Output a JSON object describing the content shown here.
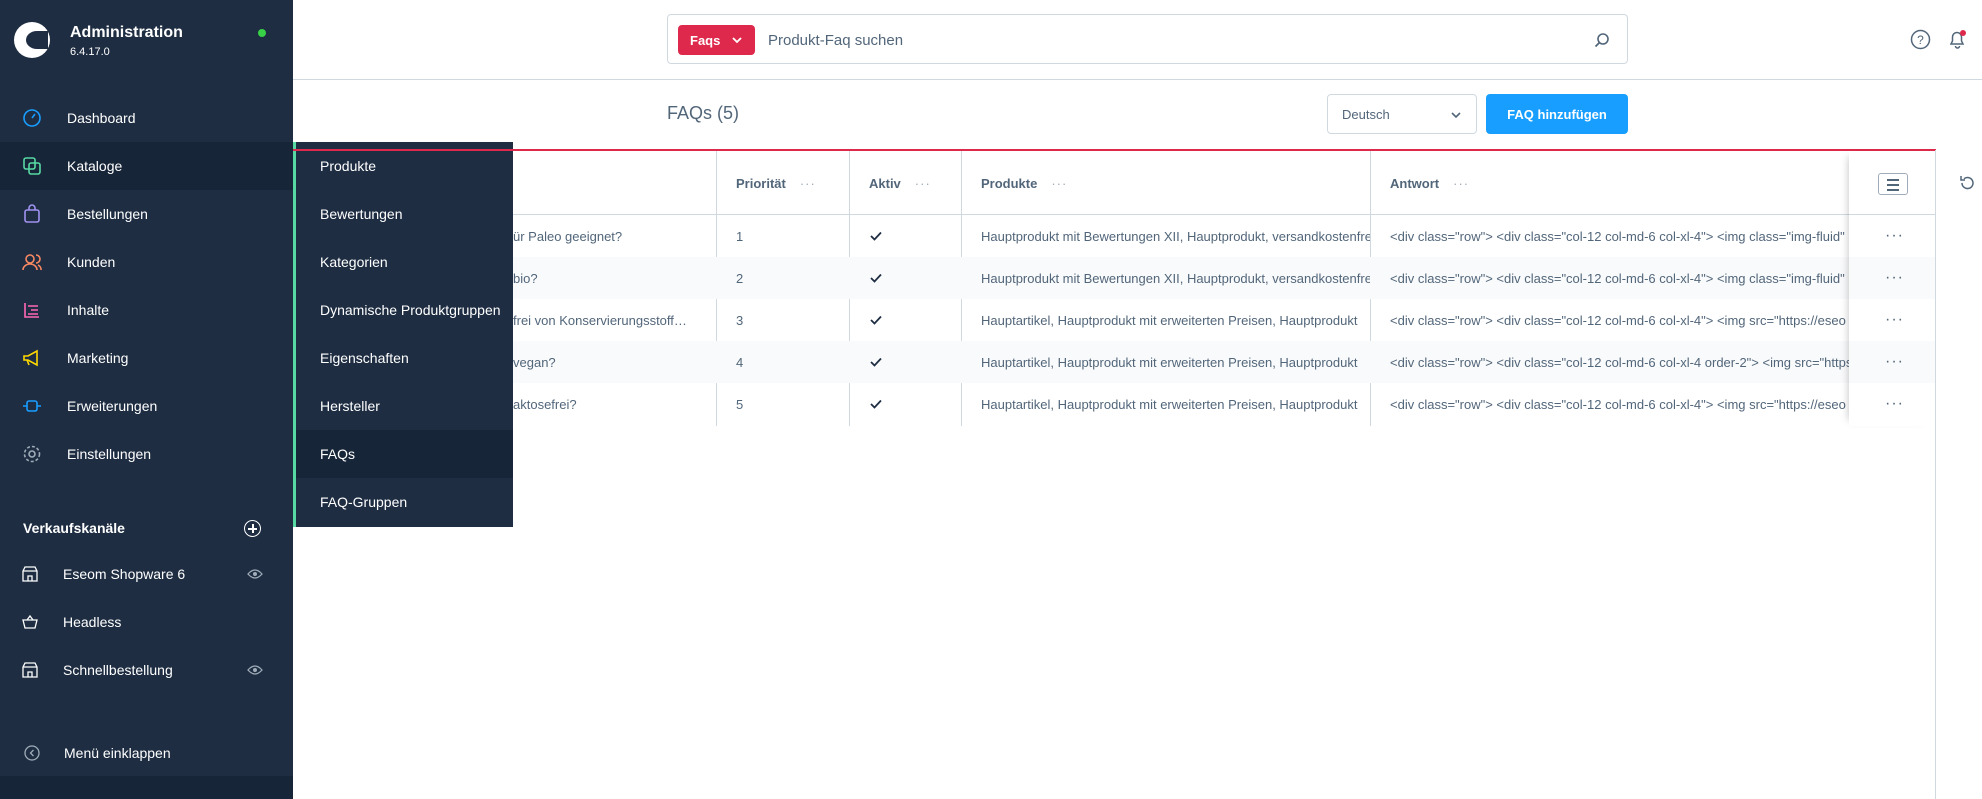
{
  "brand": {
    "title": "Administration",
    "version": "6.4.17.0"
  },
  "nav": {
    "items": [
      {
        "label": "Dashboard",
        "icon": "dashboard-icon"
      },
      {
        "label": "Kataloge",
        "icon": "catalog-icon"
      },
      {
        "label": "Bestellungen",
        "icon": "orders-icon"
      },
      {
        "label": "Kunden",
        "icon": "customers-icon"
      },
      {
        "label": "Inhalte",
        "icon": "content-icon"
      },
      {
        "label": "Marketing",
        "icon": "marketing-icon"
      },
      {
        "label": "Erweiterungen",
        "icon": "extensions-icon"
      },
      {
        "label": "Einstellungen",
        "icon": "settings-icon"
      }
    ]
  },
  "flyout": {
    "items": [
      {
        "label": "Produkte"
      },
      {
        "label": "Bewertungen"
      },
      {
        "label": "Kategorien"
      },
      {
        "label": "Dynamische Produktgruppen"
      },
      {
        "label": "Eigenschaften"
      },
      {
        "label": "Hersteller"
      },
      {
        "label": "FAQs"
      },
      {
        "label": "FAQ-Gruppen"
      }
    ]
  },
  "sales_channels": {
    "title": "Verkaufskanäle",
    "items": [
      {
        "label": "Eseom Shopware 6"
      },
      {
        "label": "Headless"
      },
      {
        "label": "Schnellbestellung"
      }
    ]
  },
  "collapse_label": "Menü einklappen",
  "search": {
    "chip": "Faqs",
    "placeholder": "Produkt-Faq suchen"
  },
  "page": {
    "title": "FAQs",
    "count": "(5)"
  },
  "language": {
    "selected": "Deutsch"
  },
  "add_button": "FAQ hinzufügen",
  "grid": {
    "headers": {
      "priority": "Priorität",
      "active": "Aktiv",
      "products": "Produkte",
      "answer": "Antwort"
    },
    "rows": [
      {
        "question": "ür Paleo geeignet?",
        "priority": "1",
        "products": "Hauptprodukt mit Bewertungen XII, Hauptprodukt, versandkostenfrei",
        "answer": "<div class=\"row\"> <div class=\"col-12 col-md-6 col-xl-4\"> <img class=\"img-fluid\""
      },
      {
        "question": "bio?",
        "priority": "2",
        "products": "Hauptprodukt mit Bewertungen XII, Hauptprodukt, versandkostenfrei",
        "answer": "<div class=\"row\"> <div class=\"col-12 col-md-6 col-xl-4\"> <img class=\"img-fluid\""
      },
      {
        "question": "frei von Konservierungsstoff…",
        "priority": "3",
        "products": "Hauptartikel, Hauptprodukt mit erweiterten Preisen, Hauptprodukt",
        "answer": "<div class=\"row\"> <div class=\"col-12 col-md-6 col-xl-4\"> <img src=\"https://eseo"
      },
      {
        "question": "vegan?",
        "priority": "4",
        "products": "Hauptartikel, Hauptprodukt mit erweiterten Preisen, Hauptprodukt",
        "answer": "<div class=\"row\"> <div class=\"col-12 col-md-6 col-xl-4 order-2\"> <img src=\"https"
      },
      {
        "question": "aktosefrei?",
        "priority": "5",
        "products": "Hauptartikel, Hauptprodukt mit erweiterten Preisen, Hauptprodukt",
        "answer": "<div class=\"row\"> <div class=\"col-12 col-md-6 col-xl-4\"> <img src=\"https://eseo"
      }
    ]
  },
  "colors": {
    "sidebar": "#1e2d42",
    "accent_red": "#de294c",
    "primary_blue": "#189eff",
    "flyout_border": "#57d9a3"
  }
}
